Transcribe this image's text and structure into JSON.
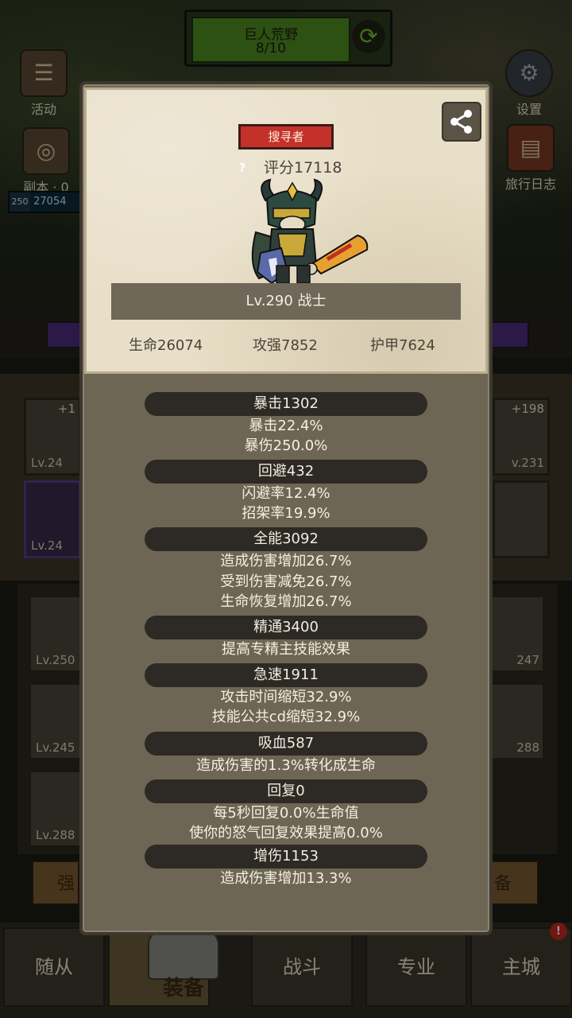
{
  "region": {
    "name": "巨人荒野",
    "progress": "8/10"
  },
  "left_menu": {
    "activity": "活动",
    "dungeon": "副本 · 0",
    "power_level": "250",
    "power_value": "27054"
  },
  "right_menu": {
    "settings": "设置",
    "journal": "旅行日志"
  },
  "background_slots": {
    "left": [
      {
        "plus": "+1",
        "level": "Lv.24"
      },
      {
        "level": "Lv.24"
      }
    ],
    "right": [
      {
        "plus": "+198",
        "level": "v.231"
      }
    ],
    "inventory_left": [
      {
        "level": "Lv.250"
      },
      {
        "level": "Lv.245"
      },
      {
        "level": "Lv.288"
      }
    ],
    "inventory_right": [
      {
        "level": "247"
      },
      {
        "level": "288"
      }
    ],
    "strip_left": "强",
    "strip_right": "备"
  },
  "bottom_nav": {
    "followers": "随从",
    "equipment": "装备",
    "battle": "战斗",
    "profession": "专业",
    "main_city": "主城",
    "badge": "!"
  },
  "hero_card": {
    "class_tag": "搜寻者",
    "score_label": "评分17118",
    "level_label": "Lv.290 战士",
    "hp": "生命26074",
    "attack": "攻强7852",
    "armor": "护甲7624"
  },
  "stats": [
    {
      "title": "暴击1302",
      "lines": [
        "暴击22.4%",
        "暴伤250.0%"
      ]
    },
    {
      "title": "回避432",
      "lines": [
        "闪避率12.4%",
        "招架率19.9%"
      ]
    },
    {
      "title": "全能3092",
      "lines": [
        "造成伤害增加26.7%",
        "受到伤害减免26.7%",
        "生命恢复增加26.7%"
      ]
    },
    {
      "title": "精通3400",
      "lines": [
        "提高专精主技能效果"
      ]
    },
    {
      "title": "急速1911",
      "lines": [
        "攻击时间缩短32.9%",
        "技能公共cd缩短32.9%"
      ]
    },
    {
      "title": "吸血587",
      "lines": [
        "造成伤害的1.3%转化成生命"
      ]
    },
    {
      "title": "回复0",
      "lines": [
        "每5秒回复0.0%生命值",
        "使你的怒气回复效果提高0.0%"
      ]
    },
    {
      "title": "增伤1153",
      "lines": [
        "造成伤害增加13.3%"
      ]
    }
  ],
  "colors": {
    "class_tag": "#c4312a",
    "pill": "#2d2924",
    "card": "#e8dfc8",
    "panel": "#6e6654"
  }
}
